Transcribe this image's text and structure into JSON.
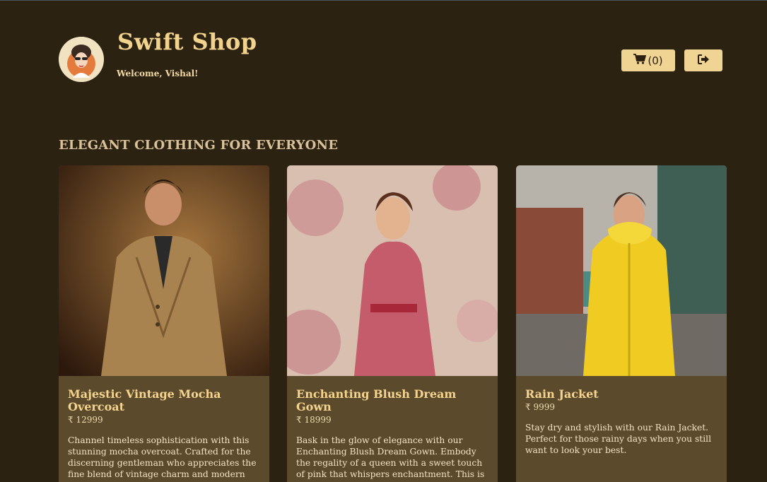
{
  "header": {
    "brand": "Swift Shop",
    "welcome": "Welcome, Vishal!",
    "cart_count": "(0)"
  },
  "section": {
    "title": "ELEGANT CLOTHING FOR EVERYONE"
  },
  "products": [
    {
      "name": "Majestic Vintage Mocha Overcoat",
      "price": "₹ 12999",
      "description": "Channel timeless sophistication with this stunning mocha overcoat. Crafted for the discerning gentleman who appreciates the fine blend of vintage charm and modern elegance."
    },
    {
      "name": "Enchanting Blush Dream Gown",
      "price": "₹ 18999",
      "description": "Bask in the glow of elegance with our Enchanting Blush Dream Gown. Embody the regality of a queen with a sweet touch of pink that whispers enchantment. This is the perfect piece for those seeking to create unforgettable memories."
    },
    {
      "name": "Rain Jacket",
      "price": "₹ 9999",
      "description": "Stay dry and stylish with our Rain Jacket. Perfect for those rainy days when you still want to look your best."
    }
  ],
  "icons": {
    "cart": "shopping-cart-icon",
    "logout": "sign-out-icon"
  },
  "colors": {
    "background": "#2c2212",
    "card": "#5b4a2c",
    "accent": "#f0d493"
  }
}
